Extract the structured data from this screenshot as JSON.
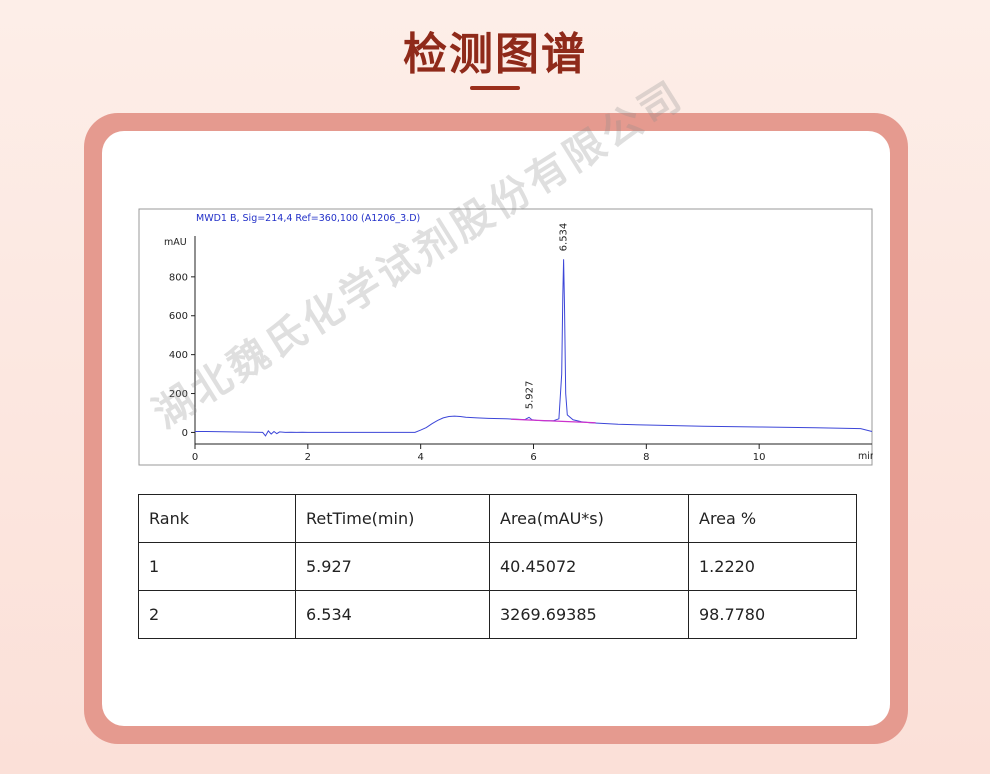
{
  "page": {
    "title": "检测图谱"
  },
  "watermark": "湖北魏氏化学试剂股份有限公司",
  "chart_data": {
    "type": "line",
    "title": "MWD1 B, Sig=214,4 Ref=360,100 (A1206_3.D)",
    "ylabel": "mAU",
    "xlabel": "min",
    "xlim": [
      0,
      12
    ],
    "ylim": [
      -80,
      1010
    ],
    "xticks": [
      0,
      2,
      4,
      6,
      8,
      10
    ],
    "yticks": [
      0,
      200,
      400,
      600,
      800
    ],
    "grid": false,
    "series": [
      {
        "color": "#3c46d8",
        "x": [
          0,
          0.2,
          1.2,
          1.25,
          1.3,
          1.35,
          1.4,
          1.45,
          1.5,
          1.6,
          1.7,
          1.8,
          1.9,
          2.0,
          3.0,
          3.9,
          4.0,
          4.1,
          4.2,
          4.3,
          4.4,
          4.5,
          4.6,
          4.7,
          4.8,
          5.0,
          5.2,
          5.5,
          5.7,
          5.85,
          5.92,
          5.97,
          6.05,
          6.2,
          6.35,
          6.45,
          6.5,
          6.52,
          6.534,
          6.55,
          6.57,
          6.6,
          6.7,
          6.85,
          7.0,
          7.5,
          8.0,
          9.0,
          10.0,
          11.0,
          11.8,
          12.0
        ],
        "y": [
          5,
          5,
          0,
          -18,
          8,
          -8,
          5,
          -6,
          3,
          0,
          1,
          0,
          1,
          0,
          0,
          0,
          12,
          25,
          45,
          62,
          75,
          82,
          84,
          82,
          78,
          75,
          72,
          70,
          68,
          66,
          78,
          66,
          62,
          60,
          60,
          70,
          300,
          700,
          890,
          650,
          200,
          90,
          65,
          55,
          50,
          42,
          38,
          32,
          28,
          24,
          20,
          5
        ]
      }
    ],
    "baseline": {
      "color": "#cc33cc",
      "x": [
        5.6,
        7.1
      ],
      "y": [
        68,
        50
      ]
    },
    "peaks": [
      {
        "label": "5.927",
        "x": 5.927,
        "y": 78
      },
      {
        "label": "6.534",
        "x": 6.534,
        "y": 890
      }
    ]
  },
  "table": {
    "headers": [
      "Rank",
      "RetTime(min)",
      "Area(mAU*s)",
      "Area %"
    ],
    "rows": [
      [
        "1",
        "5.927",
        "40.45072",
        "1.2220"
      ],
      [
        "2",
        "6.534",
        "3269.69385",
        "98.7780"
      ]
    ]
  }
}
